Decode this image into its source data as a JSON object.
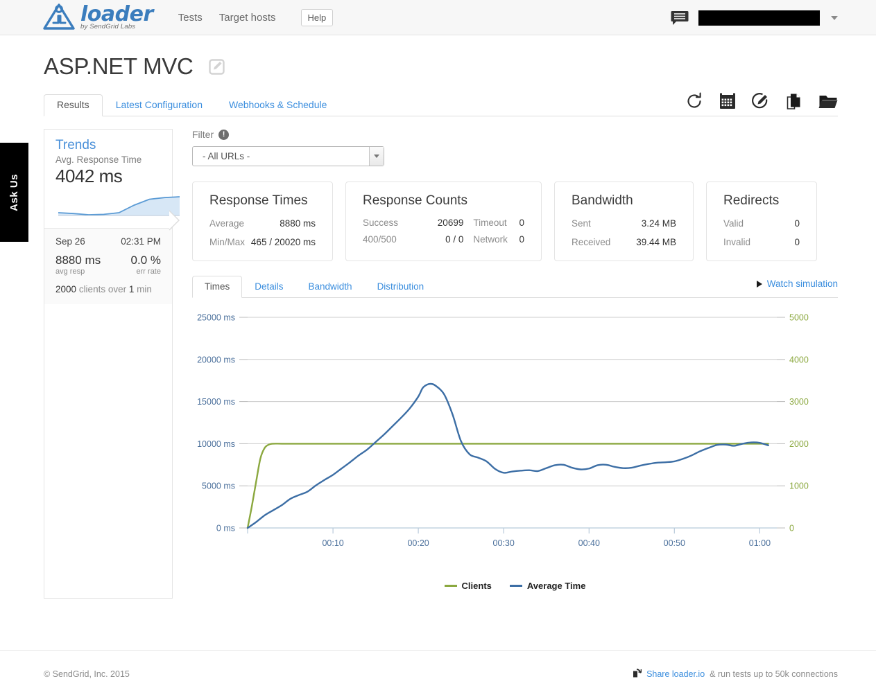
{
  "nav": {
    "brand_name": "loader",
    "brand_tagline": "by SendGrid Labs",
    "links": [
      {
        "label": "Tests"
      },
      {
        "label": "Target hosts"
      }
    ],
    "help_label": "Help",
    "chat_icon": "chat-bubble-icon",
    "account_menu_label": ""
  },
  "ask_us": {
    "label": "Ask Us"
  },
  "header": {
    "title": "ASP.NET MVC",
    "edit_icon": "edit-pencil-icon",
    "tabs": [
      {
        "label": "Results",
        "active": true
      },
      {
        "label": "Latest Configuration",
        "active": false
      },
      {
        "label": "Webhooks & Schedule",
        "active": false
      }
    ],
    "tool_icons": [
      "refresh-icon",
      "calendar-icon",
      "edit-circle-icon",
      "document-icon",
      "folder-icon"
    ]
  },
  "trends": {
    "title": "Trends",
    "subtitle": "Avg. Response Time",
    "value": "4042 ms",
    "sparkline": [
      30,
      28,
      25,
      26,
      30,
      48,
      62,
      66,
      68
    ],
    "date": "Sep 26",
    "time": "02:31 PM",
    "avg_resp_value": "8880 ms",
    "avg_resp_label": "avg resp",
    "err_rate_value": "0.0 %",
    "err_rate_label": "err rate",
    "clients_count": "2000",
    "clients_text": "clients over",
    "duration": "1",
    "duration_unit": "min"
  },
  "filter": {
    "label": "Filter",
    "info_icon": "info-exclamation-icon",
    "selected": "- All URLs -",
    "options": [
      "- All URLs -"
    ]
  },
  "cards": [
    {
      "title": "Response Times",
      "layout": "two-col",
      "rows": [
        {
          "key": "Average",
          "value": "8880 ms"
        },
        {
          "key": "Min/Max",
          "value": "465 / 20020 ms"
        }
      ]
    },
    {
      "title": "Response Counts",
      "layout": "four-col",
      "rows": [
        {
          "key1": "Success",
          "value1": "20699",
          "key2": "Timeout",
          "value2": "0"
        },
        {
          "key1": "400/500",
          "value1": "0 / 0",
          "key2": "Network",
          "value2": "0"
        }
      ]
    },
    {
      "title": "Bandwidth",
      "layout": "two-col",
      "rows": [
        {
          "key": "Sent",
          "value": "3.24 MB"
        },
        {
          "key": "Received",
          "value": "39.44 MB"
        }
      ]
    },
    {
      "title": "Redirects",
      "layout": "two-col",
      "rows": [
        {
          "key": "Valid",
          "value": "0"
        },
        {
          "key": "Invalid",
          "value": "0"
        }
      ]
    }
  ],
  "chart_tabs": [
    {
      "label": "Times",
      "active": true
    },
    {
      "label": "Details",
      "active": false
    },
    {
      "label": "Bandwidth",
      "active": false
    },
    {
      "label": "Distribution",
      "active": false
    }
  ],
  "watch_simulation": {
    "label": "Watch simulation",
    "icon": "play-triangle-icon"
  },
  "colors": {
    "clients_line": "#8ba83f",
    "avg_time_line": "#3c6ea5",
    "link_blue": "#3b8ede",
    "brand_blue": "#3b7dbd",
    "grid": "#cccccc"
  },
  "chart_data": {
    "type": "line",
    "title": "",
    "xlabel": "",
    "grid": true,
    "legend_position": "bottom",
    "x_tick_labels": [
      "00:10",
      "00:20",
      "00:30",
      "00:40",
      "00:50",
      "01:00"
    ],
    "x_tick_seconds": [
      10,
      20,
      30,
      40,
      50,
      60
    ],
    "x_range_seconds": [
      0,
      62
    ],
    "left_axis": {
      "label": "ms",
      "tick_labels": [
        "0 ms",
        "5000 ms",
        "10000 ms",
        "15000 ms",
        "20000 ms",
        "25000 ms"
      ],
      "ticks": [
        0,
        5000,
        10000,
        15000,
        20000,
        25000
      ],
      "range": [
        0,
        25000
      ],
      "color": "#4a6f9b"
    },
    "right_axis": {
      "label": "clients",
      "tick_labels": [
        "0",
        "1000",
        "2000",
        "3000",
        "4000",
        "5000"
      ],
      "ticks": [
        0,
        1000,
        2000,
        3000,
        4000,
        5000
      ],
      "range": [
        0,
        5000
      ],
      "color": "#8ba83f"
    },
    "series": [
      {
        "name": "Clients",
        "color": "#8ba83f",
        "axis": "right",
        "x": [
          0,
          0.5,
          1,
          1.5,
          2,
          2.5,
          3,
          4,
          6,
          10,
          15,
          20,
          25,
          30,
          35,
          40,
          45,
          50,
          55,
          60,
          61
        ],
        "values": [
          0,
          520,
          1100,
          1650,
          1900,
          1980,
          2000,
          2000,
          2000,
          2000,
          2000,
          2000,
          2000,
          2000,
          2000,
          2000,
          2000,
          2000,
          2000,
          2000,
          2000
        ]
      },
      {
        "name": "Average Time",
        "color": "#3c6ea5",
        "axis": "left",
        "x": [
          0,
          1,
          2,
          3,
          4,
          5,
          6,
          7,
          8,
          9,
          10,
          11,
          12,
          13,
          14,
          15,
          16,
          17,
          18,
          19,
          20,
          20.5,
          21,
          21.5,
          22,
          23,
          24,
          25,
          26,
          27,
          28,
          29,
          30,
          31,
          32,
          33,
          34,
          35,
          36,
          37,
          38,
          39,
          40,
          41,
          42,
          43,
          44,
          45,
          46,
          47,
          48,
          49,
          50,
          51,
          52,
          53,
          54,
          55,
          56,
          57,
          58,
          59,
          60,
          61
        ],
        "values": [
          0,
          700,
          1500,
          2100,
          2700,
          3450,
          3900,
          4300,
          5050,
          5700,
          6300,
          7050,
          7800,
          8600,
          9300,
          10200,
          11100,
          12100,
          13100,
          14200,
          15600,
          16600,
          17000,
          17100,
          16900,
          15900,
          13500,
          10300,
          8750,
          8350,
          7900,
          7000,
          6550,
          6700,
          6800,
          6850,
          6750,
          7100,
          7450,
          7500,
          7150,
          6950,
          7050,
          7450,
          7500,
          7250,
          7100,
          7150,
          7400,
          7600,
          7750,
          7800,
          7900,
          8200,
          8600,
          9100,
          9500,
          9850,
          9900,
          9750,
          10000,
          10150,
          10100,
          9800
        ]
      }
    ]
  },
  "legend": [
    {
      "label": "Clients",
      "color": "#8ba83f"
    },
    {
      "label": "Average Time",
      "color": "#3c6ea5"
    }
  ],
  "footer": {
    "copyright": "© SendGrid, Inc. 2015",
    "share_icon": "share-link-icon",
    "share_link": "Share loader.io",
    "share_suffix": "& run tests up to 50k connections"
  }
}
